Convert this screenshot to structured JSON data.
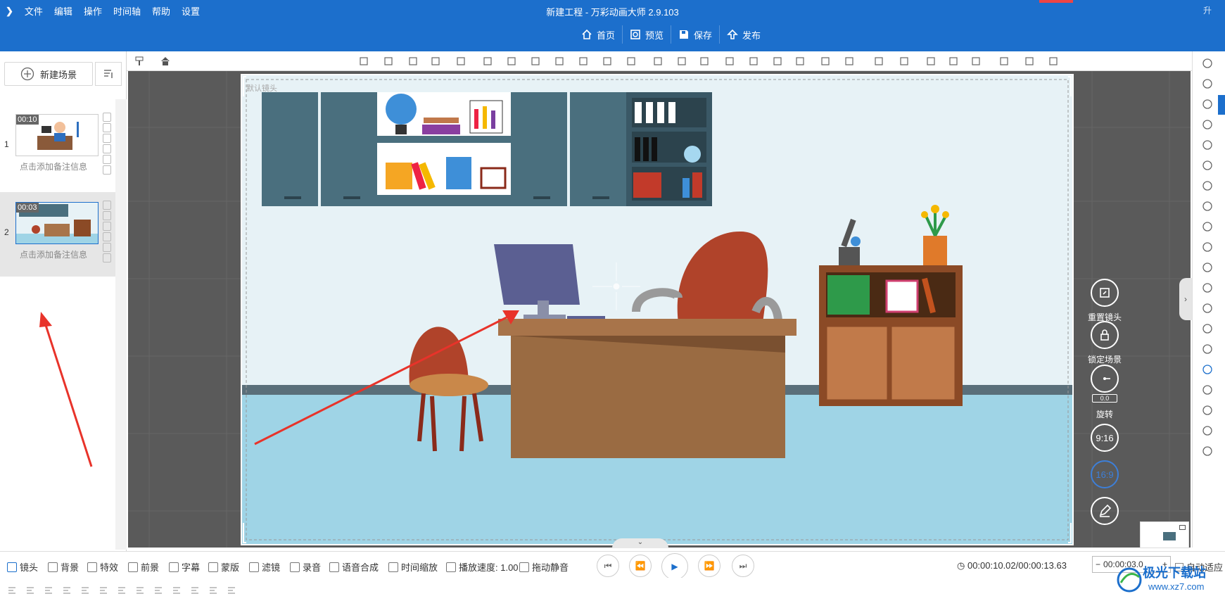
{
  "app": {
    "title": "新建工程 - 万彩动画大师 2.9.103",
    "upgrade_label": "升"
  },
  "menu": [
    "文件",
    "编辑",
    "操作",
    "时间轴",
    "帮助",
    "设置"
  ],
  "main_buttons": [
    {
      "label": "首页",
      "icon": "home-icon"
    },
    {
      "label": "预览",
      "icon": "preview-icon"
    },
    {
      "label": "保存",
      "icon": "save-icon"
    },
    {
      "label": "发布",
      "icon": "publish-icon"
    }
  ],
  "left_panel": {
    "new_scene_label": "新建场景",
    "scenes": [
      {
        "number": "1",
        "duration": "00:10",
        "note": "点击添加备注信息"
      },
      {
        "number": "2",
        "duration": "00:03",
        "note": "点击添加备注信息"
      }
    ]
  },
  "stage": {
    "camera_label": "默认镜头"
  },
  "side_controls": {
    "reset_camera": "重置镜头",
    "lock_scene": "锁定场景",
    "rotate": "旋转",
    "rotate_value": "0.0",
    "ratio_916": "9:16",
    "ratio_169": "16:9"
  },
  "bottom_toolbar": {
    "items": [
      "镜头",
      "背景",
      "特效",
      "前景",
      "字幕",
      "蒙版",
      "滤镜",
      "录音",
      "语音合成",
      "时间缩放"
    ],
    "speed_label": "播放速度: 1.00",
    "mute_label": "拖动静音",
    "timecode": "00:00:10.02/00:00:13.63",
    "time_input": "00:00:03.0",
    "autofit_label": "自动适应"
  },
  "colors": {
    "brand": "#1c6fcc",
    "arrow": "#e8332a",
    "canvas": "#5a5a5a"
  },
  "watermark": {
    "text": "极光下载站",
    "url": "www.xz7.com"
  }
}
